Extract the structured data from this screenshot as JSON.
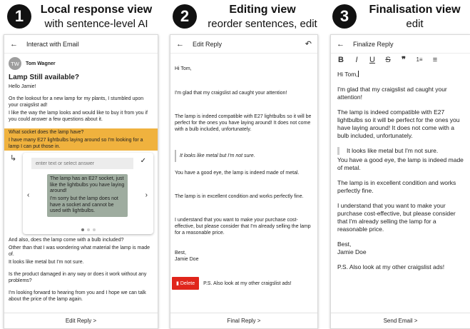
{
  "steps": [
    {
      "num": "1",
      "title": "Local response view",
      "subtitle": "with sentence-level AI"
    },
    {
      "num": "2",
      "title": "Editing view",
      "subtitle": "reorder sentences, edit"
    },
    {
      "num": "3",
      "title": "Finalisation view",
      "subtitle": "edit"
    }
  ],
  "panel1": {
    "title": "Interact with Email",
    "avatar": "TW",
    "sender": "Tom Wagner",
    "subject": "Lamp Still available?",
    "sentences": [
      "Hello Jamie!",
      "On the lookout for a new lamp for my plants, I stumbled upon your craigslist ad!",
      "I like the way the lamp looks and would like to buy it from you if you could answer a few questions about it.",
      "What socket does the lamp have?",
      "I have many E27 lightbulbs laying around so I'm looking for a lamp I can put those in."
    ],
    "answer_placeholder": "enter text or select answer",
    "suggestions": [
      "The lamp has an E27 socket, just like the lightbulbs you have laying around!",
      "I'm sorry but the lamp does not have a socket and cannot be used with lightbulbs."
    ],
    "sentences_after": [
      "And also, does the lamp come with a bulb included?",
      "Other than that I was wondering what material the lamp is made of.",
      "It looks like metal but I'm not sure.",
      "Is the product damaged in any way or does it work without any problems?",
      "I'm looking forward to hearing from you and I hope we can talk about the price of the lamp again."
    ],
    "footer": "Edit Reply >"
  },
  "panel2": {
    "title": "Edit Reply",
    "blocks": [
      "Hi Tom,",
      "I'm glad that my craigslist ad caught your attention!",
      "The lamp is indeed compatible with E27 lightbulbs so it will be perfect for the ones you have laying around! It does not come with a bulb included, unfortunately.",
      "It looks like metal but I'm not sure.",
      "You have a good eye, the lamp is indeed made of metal.",
      "The lamp is in excellent condition and works perfectly fine.",
      "I understand that you want to make your purchase cost-effective, but please consider that I'm already selling the lamp for a reasonable price.",
      "Best,",
      "Jamie Doe"
    ],
    "delete_label": "Delete",
    "delete_item": "P.S. Also look at my other craigslist ads!",
    "footer": "Final Reply >"
  },
  "panel3": {
    "title": "Finalize Reply",
    "toolbar": [
      "B",
      "I",
      "U",
      "S",
      "❞",
      "1≡",
      "≡"
    ],
    "greeting": "Hi Tom,",
    "p1": "I'm glad that my craigslist ad caught your attention!",
    "p2": "The lamp is indeed compatible with E27 lightbulbs so it will be perfect for the ones you have laying around! It does not come with a bulb included, unfortunately.",
    "quote": "It looks like metal but I'm not sure.",
    "p3": "You have a good eye, the lamp is indeed made of metal.",
    "p4": "The lamp is in excellent condition and works perfectly fine.",
    "p5": "I understand that you want to make your purchase cost-effective, but please consider that I'm already selling the lamp for a reasonable price.",
    "sign1": "Best,",
    "sign2": "Jamie Doe",
    "ps": "P.S. Also look at my other craigslist ads!",
    "footer": "Send Email >"
  }
}
